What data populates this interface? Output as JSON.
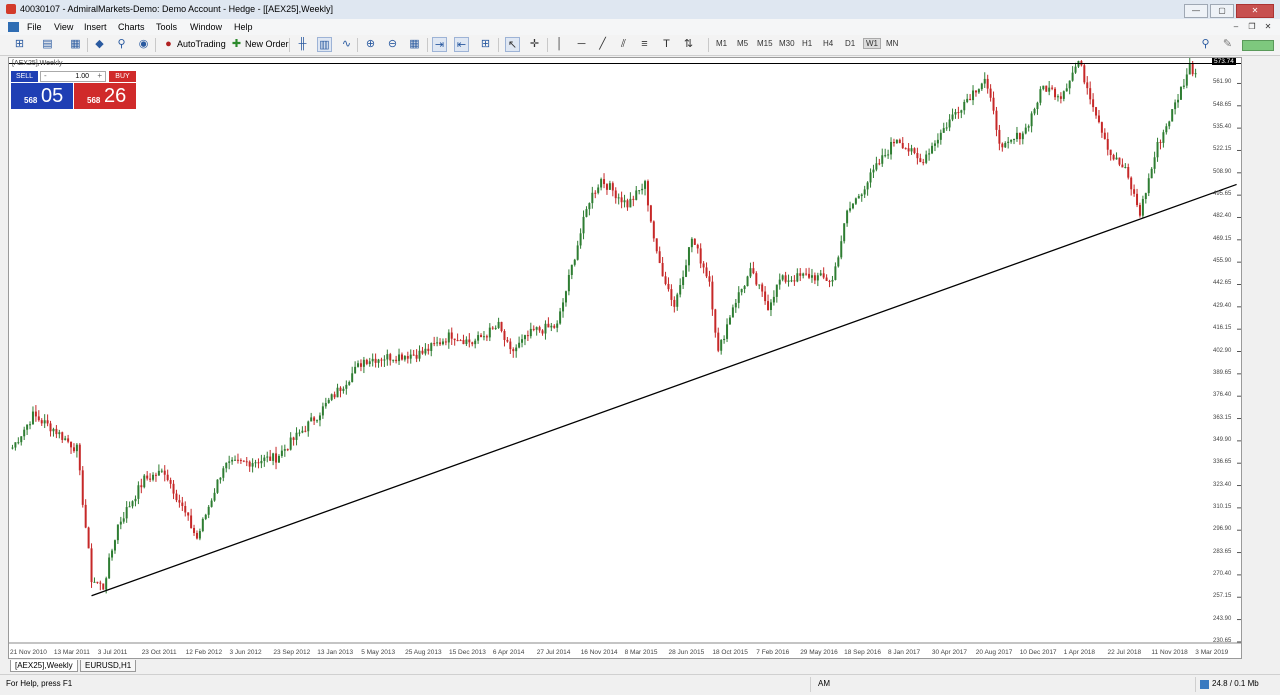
{
  "window": {
    "title": "40030107 - AdmiralMarkets-Demo: Demo Account - Hedge - [[AEX25],Weekly]",
    "controls": [
      "—",
      "▢",
      "✕"
    ]
  },
  "menu": [
    "File",
    "View",
    "Insert",
    "Charts",
    "Tools",
    "Window",
    "Help"
  ],
  "toolbar": {
    "autotrading_label": "AutoTrading",
    "new_order_label": "New Order",
    "timeframes": [
      "M1",
      "M5",
      "M15",
      "M30",
      "H1",
      "H4",
      "D1",
      "W1",
      "MN"
    ],
    "active_timeframe": "W1"
  },
  "chart": {
    "label": "[AEX25],Weekly",
    "trade_panel": {
      "sell_label": "SELL",
      "buy_label": "BUY",
      "lot": "1.00",
      "sell_small": "568",
      "sell_big": "05",
      "buy_small": "568",
      "buy_big": "26"
    },
    "current_price": "573.74"
  },
  "chart_data": {
    "type": "candlestick",
    "symbol": "[AEX25]",
    "timeframe": "Weekly",
    "ylim": [
      230,
      577
    ],
    "y_ticks": [
      "561.90",
      "548.65",
      "535.40",
      "522.15",
      "508.90",
      "495.65",
      "482.40",
      "469.15",
      "455.90",
      "442.65",
      "429.40",
      "416.15",
      "402.90",
      "389.65",
      "376.40",
      "363.15",
      "349.90",
      "336.65",
      "323.40",
      "310.15",
      "296.90",
      "283.65",
      "270.40",
      "257.15",
      "243.90",
      "230.65"
    ],
    "x_ticks": [
      "21 Nov 2010",
      "13 Mar 2011",
      "3 Jul 2011",
      "23 Oct 2011",
      "12 Feb 2012",
      "3 Jun 2012",
      "23 Sep 2012",
      "13 Jan 2013",
      "5 May 2013",
      "25 Aug 2013",
      "15 Dec 2013",
      "6 Apr 2014",
      "27 Jul 2014",
      "16 Nov 2014",
      "8 Mar 2015",
      "28 Jun 2015",
      "18 Oct 2015",
      "7 Feb 2016",
      "29 May 2016",
      "18 Sep 2016",
      "8 Jan 2017",
      "30 Apr 2017",
      "20 Aug 2017",
      "10 Dec 2017",
      "1 Apr 2018",
      "22 Jul 2018",
      "11 Nov 2018",
      "3 Mar 2019"
    ],
    "key_points": [
      {
        "t": 0,
        "v": 346
      },
      {
        "t": 7,
        "v": 365
      },
      {
        "t": 14,
        "v": 357
      },
      {
        "t": 22,
        "v": 345
      },
      {
        "t": 27,
        "v": 268
      },
      {
        "t": 31,
        "v": 263
      },
      {
        "t": 36,
        "v": 300
      },
      {
        "t": 45,
        "v": 327
      },
      {
        "t": 52,
        "v": 332
      },
      {
        "t": 63,
        "v": 292
      },
      {
        "t": 72,
        "v": 335
      },
      {
        "t": 90,
        "v": 340
      },
      {
        "t": 104,
        "v": 365
      },
      {
        "t": 120,
        "v": 398
      },
      {
        "t": 140,
        "v": 402
      },
      {
        "t": 150,
        "v": 413
      },
      {
        "t": 157,
        "v": 408
      },
      {
        "t": 166,
        "v": 418
      },
      {
        "t": 170,
        "v": 402
      },
      {
        "t": 178,
        "v": 415
      },
      {
        "t": 186,
        "v": 418
      },
      {
        "t": 192,
        "v": 460
      },
      {
        "t": 197,
        "v": 493
      },
      {
        "t": 201,
        "v": 505
      },
      {
        "t": 210,
        "v": 490
      },
      {
        "t": 216,
        "v": 502
      },
      {
        "t": 220,
        "v": 460
      },
      {
        "t": 226,
        "v": 430
      },
      {
        "t": 232,
        "v": 470
      },
      {
        "t": 238,
        "v": 445
      },
      {
        "t": 241,
        "v": 402
      },
      {
        "t": 246,
        "v": 430
      },
      {
        "t": 252,
        "v": 450
      },
      {
        "t": 258,
        "v": 430
      },
      {
        "t": 262,
        "v": 445
      },
      {
        "t": 272,
        "v": 448
      },
      {
        "t": 280,
        "v": 445
      },
      {
        "t": 285,
        "v": 485
      },
      {
        "t": 295,
        "v": 512
      },
      {
        "t": 302,
        "v": 530
      },
      {
        "t": 310,
        "v": 515
      },
      {
        "t": 322,
        "v": 545
      },
      {
        "t": 332,
        "v": 565
      },
      {
        "t": 338,
        "v": 522
      },
      {
        "t": 346,
        "v": 535
      },
      {
        "t": 352,
        "v": 560
      },
      {
        "t": 358,
        "v": 555
      },
      {
        "t": 364,
        "v": 575
      },
      {
        "t": 370,
        "v": 545
      },
      {
        "t": 375,
        "v": 520
      },
      {
        "t": 380,
        "v": 510
      },
      {
        "t": 385,
        "v": 485
      },
      {
        "t": 391,
        "v": 525
      },
      {
        "t": 396,
        "v": 545
      },
      {
        "t": 402,
        "v": 572
      },
      {
        "t": 404,
        "v": 568
      }
    ],
    "trendline": {
      "from": {
        "t": 27,
        "v": 258
      },
      "to": {
        "t": 418,
        "v": 502
      }
    },
    "current_price_line": 573.74,
    "grid": false
  },
  "tabs": [
    "[AEX25],Weekly",
    "EURUSD,H1"
  ],
  "active_tab": "[AEX25],Weekly",
  "status": {
    "help": "For Help, press F1",
    "profile": "AM",
    "traffic": "24.8 / 0.1 Mb"
  }
}
